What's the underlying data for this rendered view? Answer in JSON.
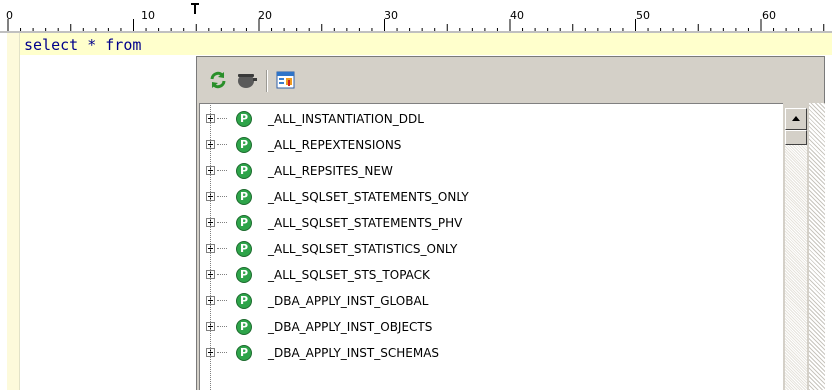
{
  "ruler": {
    "ticks": [
      "0",
      "10",
      "20",
      "30",
      "40",
      "50",
      "60"
    ]
  },
  "editor": {
    "code": "select * from"
  },
  "toolbar": {
    "buttons": [
      {
        "icon": "refresh-icon",
        "name": "refresh-button"
      },
      {
        "icon": "pot-icon",
        "name": "object-button"
      },
      {
        "icon": "table-browser-icon",
        "name": "browse-button"
      }
    ]
  },
  "tree": {
    "items": [
      "_ALL_INSTANTIATION_DDL",
      "_ALL_REPEXTENSIONS",
      "_ALL_REPSITES_NEW",
      "_ALL_SQLSET_STATEMENTS_ONLY",
      "_ALL_SQLSET_STATEMENTS_PHV",
      "_ALL_SQLSET_STATISTICS_ONLY",
      "_ALL_SQLSET_STS_TOPACK",
      "_DBA_APPLY_INST_GLOBAL",
      "_DBA_APPLY_INST_OBJECTS",
      "_DBA_APPLY_INST_SCHEMAS"
    ],
    "icon_letter": "P"
  },
  "colors": {
    "editor_line": "#ffffcc",
    "code_text": "#00008b",
    "package_icon": "#2ea44a"
  }
}
